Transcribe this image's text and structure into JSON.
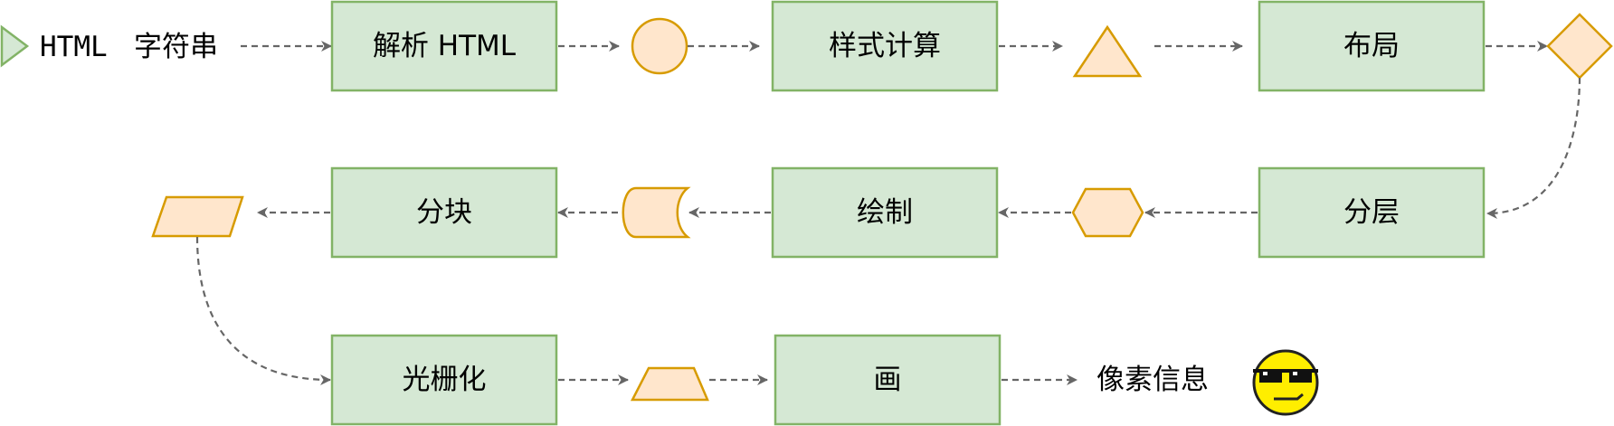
{
  "labels": {
    "input_html": "HTML",
    "input_string": "字符串",
    "parse": "解析 HTML",
    "style": "样式计算",
    "layout": "布局",
    "layer": "分层",
    "paint": "绘制",
    "tile": "分块",
    "raster": "光栅化",
    "draw": "画",
    "output": "像素信息"
  },
  "colors": {
    "process_fill": "#d5e8d4",
    "process_stroke": "#82b366",
    "data_fill": "#ffe6cc",
    "data_stroke": "#d79b00",
    "edge": "#666666"
  },
  "icons": [
    "play-triangle-icon",
    "sunglasses-smiley-icon"
  ]
}
